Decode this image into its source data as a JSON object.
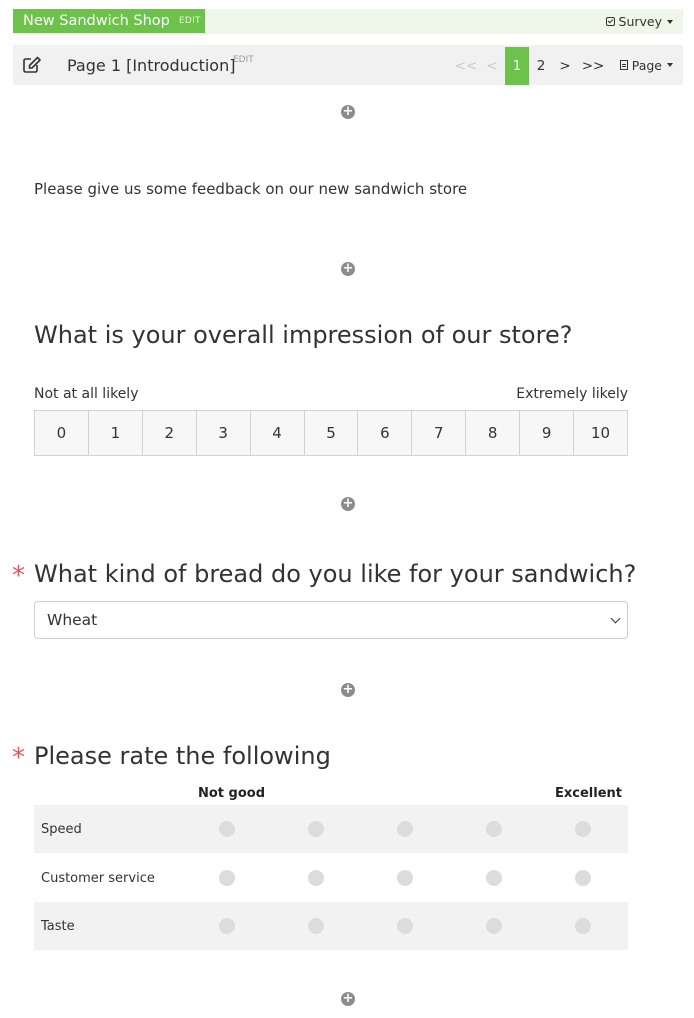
{
  "survey": {
    "title": "New Sandwich Shop",
    "edit_label": "EDIT",
    "menu_label": "Survey"
  },
  "page": {
    "title": "Page 1 [Introduction]",
    "edit_label": "EDIT",
    "pager": {
      "first": "<<",
      "prev": "<",
      "pages": [
        "1",
        "2"
      ],
      "current": "1",
      "next": ">",
      "last": ">>"
    },
    "menu_label": "Page"
  },
  "add_question_symbol": "+",
  "intro": {
    "text": "Please give us some feedback on our new sandwich store"
  },
  "q1": {
    "title": "What is your overall impression of our store?",
    "low_label": "Not at all likely",
    "high_label": "Extremely likely",
    "options": [
      "0",
      "1",
      "2",
      "3",
      "4",
      "5",
      "6",
      "7",
      "8",
      "9",
      "10"
    ]
  },
  "q2": {
    "required_mark": "*",
    "title": "What kind of bread do you like for your sandwich?",
    "selected": "Wheat"
  },
  "q3": {
    "required_mark": "*",
    "title": "Please rate the following",
    "col_low": "Not good",
    "col_high": "Excellent",
    "rows": [
      "Speed",
      "Customer service",
      "Taste"
    ],
    "columns_count": 5
  },
  "colors": {
    "accent": "#6cc24a",
    "required": "#e4555a"
  }
}
